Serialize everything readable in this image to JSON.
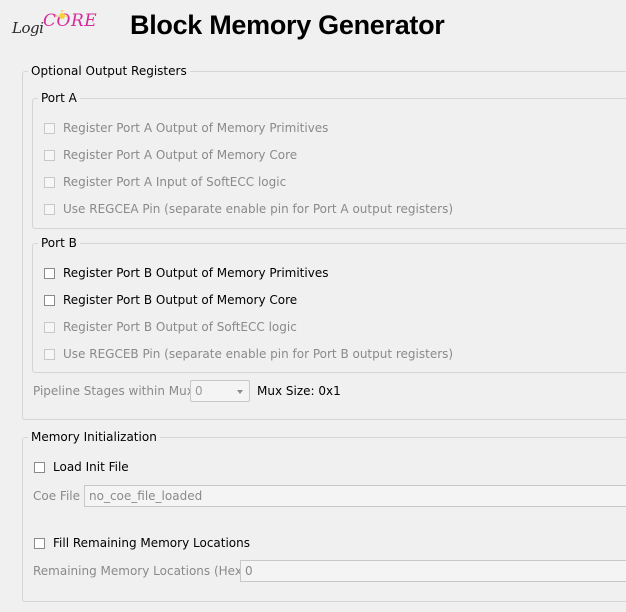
{
  "header": {
    "logo_text_logi": "Logi",
    "logo_text_core": "CORE",
    "title": "Block Memory Generator"
  },
  "optional_output_registers": {
    "legend": "Optional Output Registers",
    "port_a": {
      "legend": "Port A",
      "options": [
        {
          "label": "Register Port A Output of Memory Primitives",
          "checked": false,
          "enabled": false
        },
        {
          "label": "Register Port A Output of Memory Core",
          "checked": false,
          "enabled": false
        },
        {
          "label": "Register Port A Input of SoftECC logic",
          "checked": false,
          "enabled": false
        },
        {
          "label": "Use REGCEA Pin (separate enable pin for Port A output registers)",
          "checked": false,
          "enabled": false
        }
      ]
    },
    "port_b": {
      "legend": "Port B",
      "options": [
        {
          "label": "Register Port B Output of Memory Primitives",
          "checked": false,
          "enabled": true
        },
        {
          "label": "Register Port B Output of Memory Core",
          "checked": false,
          "enabled": true
        },
        {
          "label": "Register Port B Output of SoftECC logic",
          "checked": false,
          "enabled": false
        },
        {
          "label": "Use REGCEB Pin (separate enable pin for Port B output registers)",
          "checked": false,
          "enabled": false
        }
      ]
    },
    "pipeline_stages": {
      "label": "Pipeline Stages within Mux",
      "value": "0",
      "mux_size": "Mux Size: 0x1"
    }
  },
  "memory_initialization": {
    "legend": "Memory Initialization",
    "load_init_file": {
      "label": "Load Init File",
      "checked": false
    },
    "coe_file": {
      "label": "Coe File",
      "value": "no_coe_file_loaded"
    },
    "fill_remaining": {
      "label": "Fill Remaining Memory Locations",
      "checked": false
    },
    "remaining_locations": {
      "label": "Remaining Memory Locations (Hex)",
      "value": "0"
    }
  }
}
